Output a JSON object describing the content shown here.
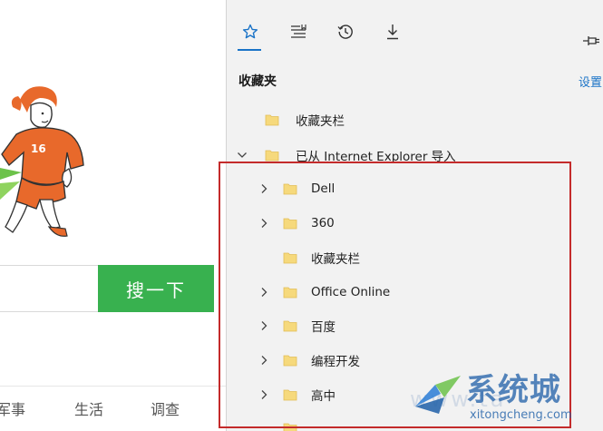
{
  "page": {
    "search_button": "搜一下",
    "nav_links": [
      "军事",
      "生活",
      "调查"
    ]
  },
  "hub": {
    "tabs": [
      {
        "name": "favorites",
        "icon": "star-icon"
      },
      {
        "name": "reading-list",
        "icon": "reading-list-icon"
      },
      {
        "name": "history",
        "icon": "history-icon"
      },
      {
        "name": "downloads",
        "icon": "download-icon"
      }
    ],
    "active_tab": "favorites",
    "pin_icon": "pin-icon",
    "title": "收藏夹",
    "settings_label": "设置",
    "items": [
      {
        "label": "收藏夹栏",
        "level": 0,
        "expander": "none"
      },
      {
        "label": "已从 Internet Explorer 导入",
        "level": 0,
        "expander": "expanded"
      },
      {
        "label": "Dell",
        "level": 1,
        "expander": "collapsed"
      },
      {
        "label": "360",
        "level": 1,
        "expander": "collapsed"
      },
      {
        "label": "收藏夹栏",
        "level": 1,
        "expander": "none"
      },
      {
        "label": "Office Online",
        "level": 1,
        "expander": "collapsed"
      },
      {
        "label": "百度",
        "level": 1,
        "expander": "collapsed"
      },
      {
        "label": "编程开发",
        "level": 1,
        "expander": "collapsed"
      },
      {
        "label": "高中",
        "level": 1,
        "expander": "collapsed"
      }
    ]
  },
  "watermark": {
    "title": "系统城",
    "url": "xitongcheng.com",
    "faded_text": "www.ta"
  },
  "colors": {
    "accent": "#1a73c7",
    "search_green": "#38b14f",
    "annotation_red": "#c42b2b",
    "folder_yellow": "#f6d97c",
    "pane_bg": "#f2f2f2",
    "doodle_orange": "#e8692b"
  }
}
